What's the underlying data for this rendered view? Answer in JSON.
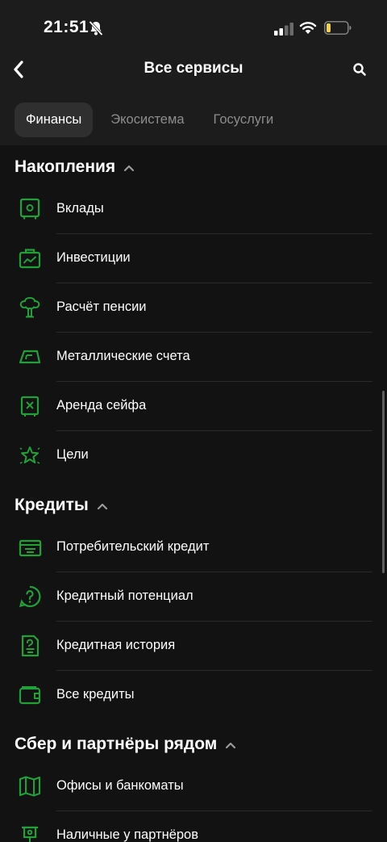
{
  "status_bar": {
    "time": "21:51"
  },
  "nav": {
    "title": "Все сервисы"
  },
  "tabs": [
    {
      "label": "Финансы",
      "active": true
    },
    {
      "label": "Экосистема",
      "active": false
    },
    {
      "label": "Госуслуги",
      "active": false
    }
  ],
  "sections": [
    {
      "title": "Накопления",
      "items": [
        {
          "label": "Вклады",
          "icon": "safe-icon"
        },
        {
          "label": "Инвестиции",
          "icon": "briefcase-chart-icon"
        },
        {
          "label": "Расчёт пенсии",
          "icon": "tree-icon"
        },
        {
          "label": "Металлические счета",
          "icon": "gold-bar-icon"
        },
        {
          "label": "Аренда сейфа",
          "icon": "safe-box-icon"
        },
        {
          "label": "Цели",
          "icon": "star-icon"
        }
      ]
    },
    {
      "title": "Кредиты",
      "items": [
        {
          "label": "Потребительский кредит",
          "icon": "card-icon"
        },
        {
          "label": "Кредитный потенциал",
          "icon": "question-circle-icon"
        },
        {
          "label": "Кредитная история",
          "icon": "document-icon"
        },
        {
          "label": "Все кредиты",
          "icon": "wallet-icon"
        }
      ]
    },
    {
      "title": "Сбер и партнёры рядом",
      "items": [
        {
          "label": "Офисы и банкоматы",
          "icon": "map-icon"
        },
        {
          "label": "Наличные у партнёров",
          "icon": "cash-point-icon"
        }
      ]
    }
  ],
  "colors": {
    "accent": "#21a038",
    "background": "#121212",
    "header": "#1c1c1c"
  }
}
